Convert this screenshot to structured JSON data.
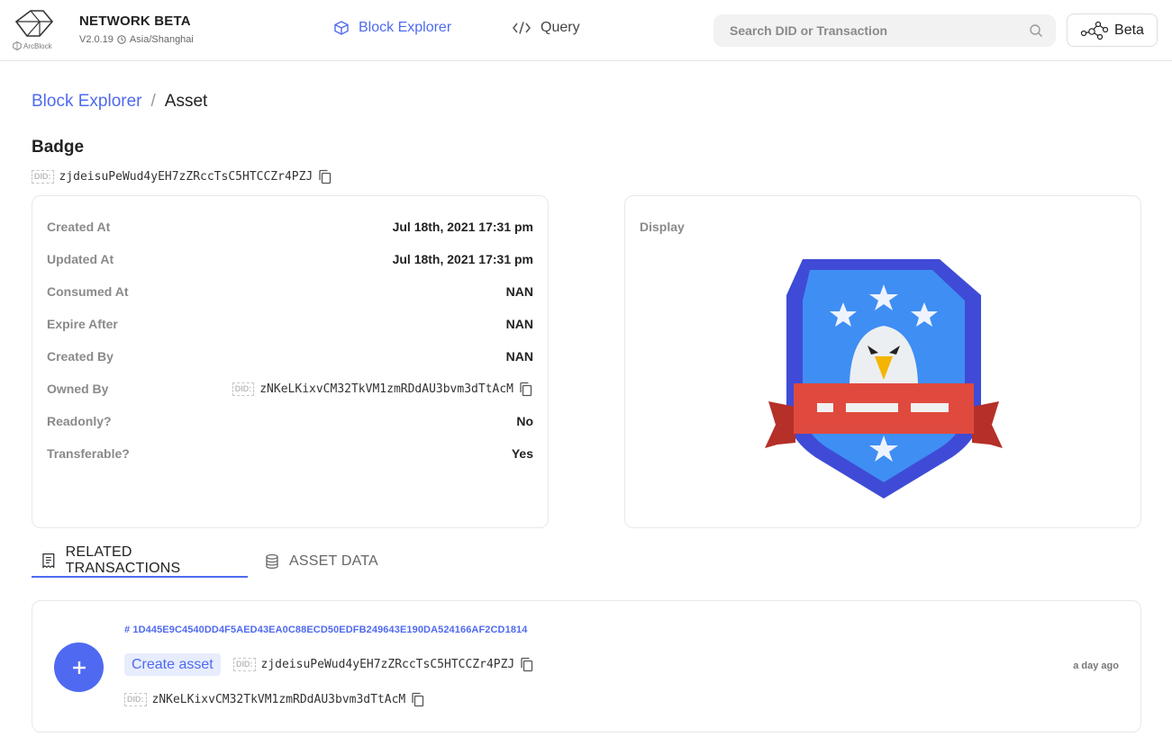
{
  "header": {
    "brand": "ArcBlock",
    "title": "NETWORK BETA",
    "version": "V2.0.19",
    "timezone": "Asia/Shanghai",
    "nav": [
      {
        "label": "Block Explorer",
        "active": true
      },
      {
        "label": "Query",
        "active": false
      }
    ],
    "search_placeholder": "Search DID or Transaction",
    "beta_label": "Beta"
  },
  "breadcrumb": {
    "root": "Block Explorer",
    "separator": "/",
    "current": "Asset"
  },
  "asset": {
    "title": "Badge",
    "did_label": "DID:",
    "did": "zjdeisuPeWud4yEH7zZRccTsC5HTCCZr4PZJ",
    "fields": [
      {
        "label": "Created At",
        "value": "Jul 18th, 2021 17:31 pm"
      },
      {
        "label": "Updated At",
        "value": "Jul 18th, 2021 17:31 pm"
      },
      {
        "label": "Consumed At",
        "value": "NAN"
      },
      {
        "label": "Expire After",
        "value": "NAN"
      },
      {
        "label": "Created By",
        "value": "NAN"
      },
      {
        "label": "Owned By",
        "value": "zNKeLKixvCM32TkVM1zmRDdAU3bvm3dTtAcM"
      },
      {
        "label": "Readonly?",
        "value": "No"
      },
      {
        "label": "Transferable?",
        "value": "Yes"
      }
    ],
    "display_label": "Display"
  },
  "tabs": [
    {
      "label": "RELATED TRANSACTIONS",
      "active": true
    },
    {
      "label": "ASSET DATA",
      "active": false
    }
  ],
  "transactions": [
    {
      "hash": "# 1D445E9C4540DD4F5AED43EA0C88ECD50EDFB249643E190DA524166AF2CD1814",
      "type": "Create asset",
      "did_label": "DID:",
      "asset_did": "zjdeisuPeWud4yEH7zZRccTsC5HTCCZr4PZJ",
      "owner_did": "zNKeLKixvCM32TkVM1zmRDdAU3bvm3dTtAcM",
      "time": "a day ago"
    }
  ],
  "colors": {
    "accent": "#4f6af0",
    "badge_outer": "#3f4bd6",
    "badge_inner": "#3f8ef4",
    "ribbon": "#e04a3e",
    "ribbon_dark": "#b53028",
    "beak": "#f4b400"
  }
}
